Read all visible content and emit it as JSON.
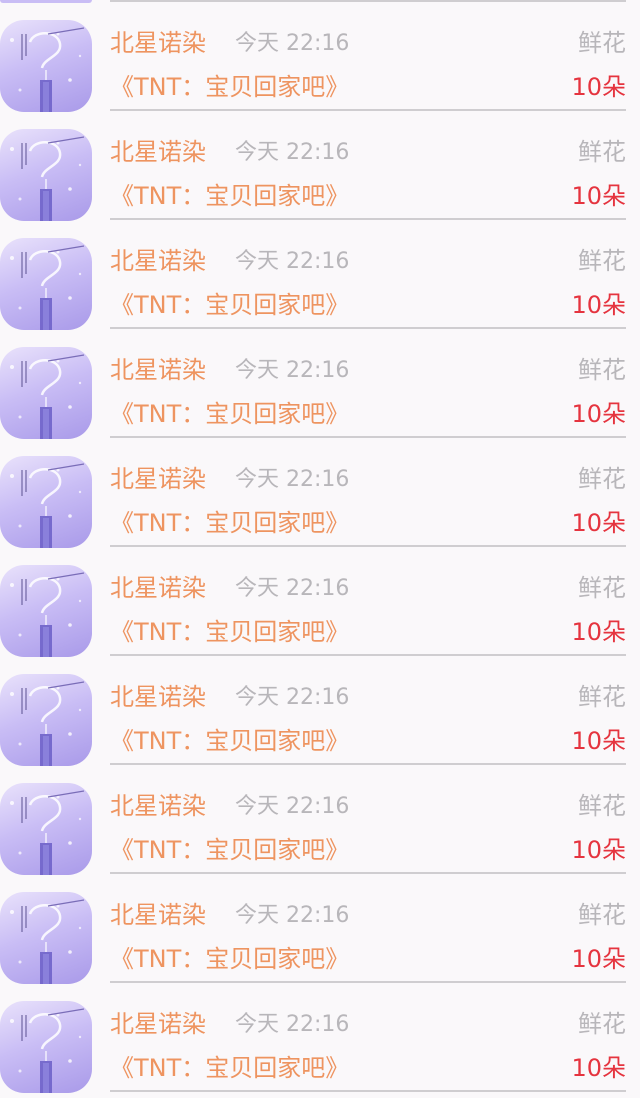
{
  "rows": [
    {
      "name": "北星诺染",
      "time": "今天 22:16",
      "gift": "鲜花",
      "book": "《TNT：宝贝回家吧》",
      "count": "10朵"
    },
    {
      "name": "北星诺染",
      "time": "今天 22:16",
      "gift": "鲜花",
      "book": "《TNT：宝贝回家吧》",
      "count": "10朵"
    },
    {
      "name": "北星诺染",
      "time": "今天 22:16",
      "gift": "鲜花",
      "book": "《TNT：宝贝回家吧》",
      "count": "10朵"
    },
    {
      "name": "北星诺染",
      "time": "今天 22:16",
      "gift": "鲜花",
      "book": "《TNT：宝贝回家吧》",
      "count": "10朵"
    },
    {
      "name": "北星诺染",
      "time": "今天 22:16",
      "gift": "鲜花",
      "book": "《TNT：宝贝回家吧》",
      "count": "10朵"
    },
    {
      "name": "北星诺染",
      "time": "今天 22:16",
      "gift": "鲜花",
      "book": "《TNT：宝贝回家吧》",
      "count": "10朵"
    },
    {
      "name": "北星诺染",
      "time": "今天 22:16",
      "gift": "鲜花",
      "book": "《TNT：宝贝回家吧》",
      "count": "10朵"
    },
    {
      "name": "北星诺染",
      "time": "今天 22:16",
      "gift": "鲜花",
      "book": "《TNT：宝贝回家吧》",
      "count": "10朵"
    },
    {
      "name": "北星诺染",
      "time": "今天 22:16",
      "gift": "鲜花",
      "book": "《TNT：宝贝回家吧》",
      "count": "10朵"
    },
    {
      "name": "北星诺染",
      "time": "今天 22:16",
      "gift": "鲜花",
      "book": "《TNT：宝贝回家吧》",
      "count": "10朵"
    }
  ],
  "colors": {
    "name": "#ee9460",
    "muted": "#b8b6ba",
    "count": "#e5343f",
    "background": "#faf8fa",
    "divider": "#cfcdd0"
  },
  "icons": {
    "avatar": "user-avatar-icon"
  }
}
